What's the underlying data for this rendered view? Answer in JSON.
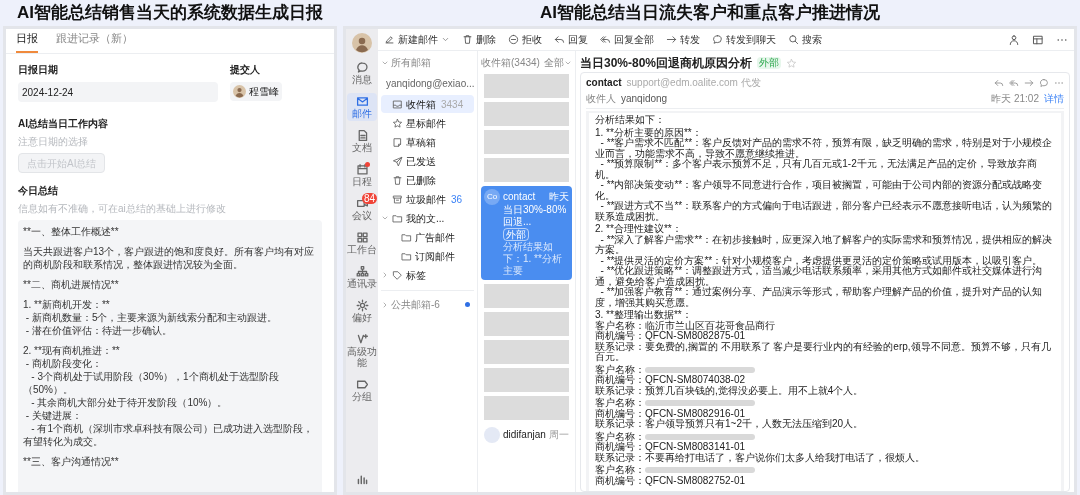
{
  "titles": [
    "AI智能总结销售当天的系统数据生成日报",
    "AI智能总结当日流失客户和重点客户推进情况"
  ],
  "report": {
    "tabs": [
      {
        "label": "日报",
        "selected": true
      },
      {
        "label": "跟进记录（新）",
        "selected": false
      }
    ],
    "date": {
      "label": "日报日期",
      "value": "2024-12-24"
    },
    "submitter": {
      "label": "提交人",
      "name": "程雪峰"
    },
    "ai": {
      "label": "AI总结当日工作内容",
      "hint": "注意日期的选择",
      "button": "点击开始AI总结",
      "disabled": true
    },
    "summary": {
      "label": "今日总结",
      "hint": "信息如有不准确，可在ai总结的基础上进行修改",
      "paragraphs": [
        [
          "**一、整体工作概述**"
        ],
        [
          "当天共跟进客户13个，客户跟进的饱和度良好。所有客户均有对应的商机阶段和联系情况，整体跟进情况较为全面。"
        ],
        [
          "**二、商机进展情况**"
        ],
        [
          "1. **新商机开发：**",
          " - 新商机数量：5个，主要来源为新线索分配和主动跟进。",
          " - 潜在价值评估：待进一步确认。"
        ],
        [
          "2. **现有商机推进：**",
          " - 商机阶段变化：",
          "   - 3个商机处于试用阶段（30%），1个商机处于选型阶段（50%）。",
          "   - 其余商机大部分处于待开发阶段（10%）。",
          " - 关键进展：",
          "   - 有1个商机（深圳市求卓科技有限公司）已成功进入选型阶段，有望转化为成交。"
        ],
        [
          "**三、客户沟通情况**"
        ]
      ]
    }
  },
  "mail": {
    "nav": [
      {
        "label": "消息",
        "selected": false
      },
      {
        "label": "邮件",
        "selected": true
      },
      {
        "label": "文档",
        "selected": false
      },
      {
        "label": "日程",
        "selected": false,
        "dot": true
      },
      {
        "label": "会议",
        "selected": false,
        "badge": "84"
      },
      {
        "label": "工作台",
        "selected": false
      },
      {
        "label": "通讯录",
        "selected": false
      },
      {
        "label": "偏好",
        "selected": false
      },
      {
        "label": "高级功能",
        "selected": false
      },
      {
        "label": "分组",
        "selected": false
      }
    ],
    "toolbar": [
      {
        "label": "新建邮件",
        "dropdown": true
      },
      {
        "label": "删除"
      },
      {
        "label": "拒收"
      },
      {
        "label": "回复"
      },
      {
        "label": "回复全部"
      },
      {
        "label": "转发"
      },
      {
        "label": "转发到聊天"
      },
      {
        "label": "搜索"
      }
    ],
    "folders": {
      "header": "所有邮箱",
      "account": "yanqidong@exiao...",
      "items": [
        {
          "label": "收件箱",
          "count": "3434",
          "count_emphasis": false,
          "selected": true
        },
        {
          "label": "星标邮件",
          "selected": false
        },
        {
          "label": "草稿箱",
          "selected": false
        },
        {
          "label": "已发送",
          "selected": false
        },
        {
          "label": "已删除",
          "selected": false
        },
        {
          "label": "垃圾邮件",
          "count": "36",
          "count_emphasis": true,
          "selected": false
        },
        {
          "label": "我的文...",
          "selected": false,
          "expanded": true,
          "children": [
            {
              "label": "广告邮件",
              "selected": false
            },
            {
              "label": "订阅邮件",
              "selected": false
            }
          ]
        },
        {
          "label": "标签",
          "selected": false,
          "expanded": false
        }
      ],
      "public": {
        "label": "公共邮箱-6",
        "unread": true
      }
    },
    "list": {
      "header": "收件箱(3434)",
      "filter": "全部",
      "items": [
        {
          "kind": "redacted"
        },
        {
          "kind": "redacted"
        },
        {
          "kind": "redacted"
        },
        {
          "kind": "redacted"
        },
        {
          "kind": "message",
          "selected": true,
          "avatar": "Co",
          "sender": "contact",
          "time": "昨天",
          "subject": "当日30%-80%回退...",
          "tag": "外部",
          "preview": "分析结果如下：1. **分析主要"
        },
        {
          "kind": "redacted"
        },
        {
          "kind": "redacted"
        },
        {
          "kind": "redacted"
        },
        {
          "kind": "redacted"
        },
        {
          "kind": "redacted"
        },
        {
          "kind": "message",
          "selected": false,
          "sender": "didifanjan",
          "time": "周一"
        }
      ]
    },
    "reader": {
      "title": "当日30%-80%回退商机原因分析",
      "tag": "外部",
      "starred": false,
      "sender": "contact",
      "via": "support@edm.oalite.com 代发",
      "to_label": "收件人",
      "to": "yanqidong",
      "time": "昨天 21:02",
      "details": "详情",
      "body": [
        [
          "分析结果如下："
        ],
        [
          "1. **分析主要的原因**：",
          "  - **客户需求不匹配**：客户反馈对产品的需求不符，预算有限，缺乏明确的需求，特别是对于小规模企业而言，功能需求不高，导致不愿意继续推进。",
          "  - **预算限制**：多个客户表示预算不足，只有几百元或1-2千元，无法满足产品的定价，导致放弃商机。",
          "  - **内部决策变动**：客户领导不同意进行合作，项目被搁置，可能由于公司内部的资源分配或战略变化。",
          "  - **跟进方式不当**：联系客户的方式偏向于电话跟进，部分客户已经表示不愿意接听电话，认为频繁的联系造成困扰。"
        ],
        [
          "2. **合理性建议**：",
          "  - **深入了解客户需求**：在初步接触时，应更深入地了解客户的实际需求和预算情况，提供相应的解决方案。",
          "  - **提供灵活的定价方案**：针对小规模客户，考虑提供更灵活的定价策略或试用版本，以吸引客户。",
          "  - **优化跟进策略**：调整跟进方式，适当减少电话联系频率，采用其他方式如邮件或社交媒体进行沟通，避免给客户造成困扰。",
          "  - **加强客户教育**：通过案例分享、产品演示等形式，帮助客户理解产品的价值，提升对产品的认知度，增强其购买意愿。"
        ],
        [
          "3. **整理输出数据**：",
          {
            "label": "客户名称：",
            "value": "临沂市兰山区百花哥食品商行"
          },
          "商机编号：QFCN-SM8082875-01",
          "联系记录：要免费的,搁置的 不用联系了 客户是要行业内的有经验的erp,领导不同意。预算不够，只有几百元。"
        ],
        [
          {
            "label": "客户名称：",
            "redacted": true
          },
          "商机编号：QFCN-SM8074038-02",
          "联系记录：预算几百块钱的,觉得没必要上。用不上就4个人。"
        ],
        [
          {
            "label": "客户名称：",
            "redacted": true
          },
          "商机编号：QFCN-SM8082916-01",
          "联系记录：客户领导预算只有1~2千，人数无法压缩到20人。"
        ],
        [
          {
            "label": "客户名称：",
            "redacted": true
          },
          "商机编号：QFCN-SM8083141-01",
          "联系记录：不要再给打电话了，客户说你们太多人给我打电话了，很烦人。"
        ],
        [
          {
            "label": "客户名称：",
            "redacted": true
          },
          "商机编号：QFCN-SM8082752-01"
        ]
      ]
    }
  }
}
